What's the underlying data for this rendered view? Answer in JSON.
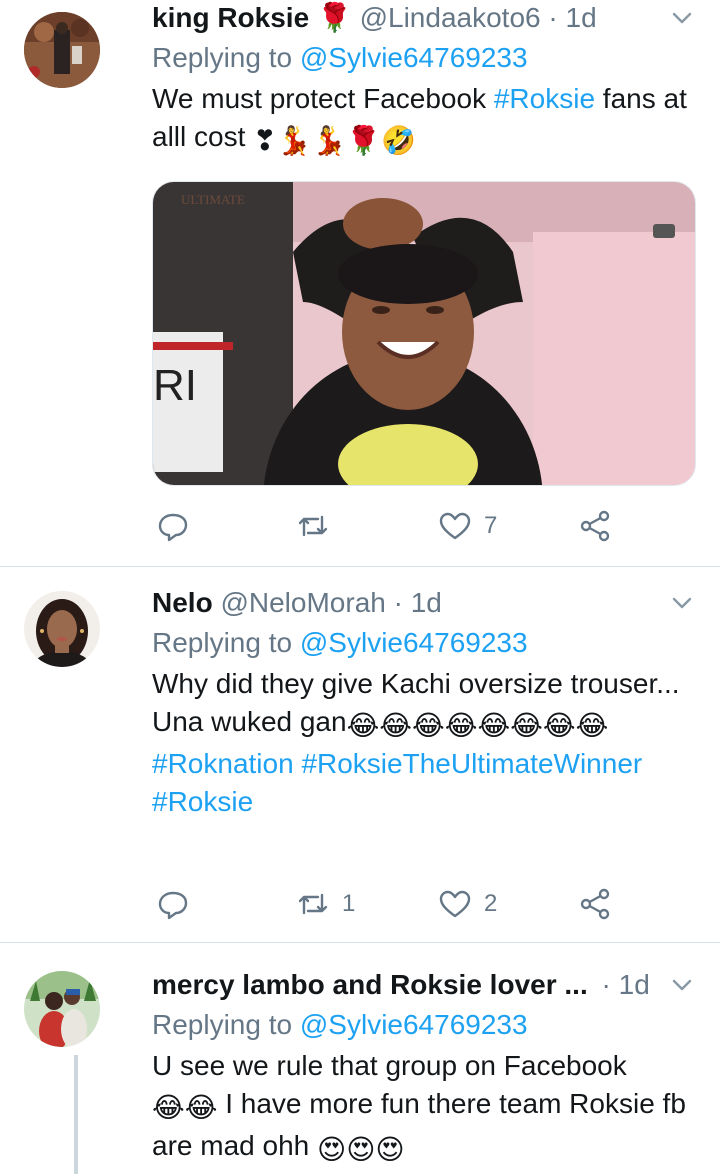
{
  "tweets": [
    {
      "name": "king Roksie 🌹",
      "handle": "@Lindaakoto6",
      "dot": "·",
      "time": "1d",
      "reply_prefix": "Replying to ",
      "reply_to": "@Sylvie64769233",
      "text_1": "We must protect Facebook ",
      "hashtag_1": "#Roksie",
      "text_2": " fans at alll cost",
      "emoji_tail": "❣💃💃🌹🤣",
      "media_overlay_text": "RI",
      "media_logo_text": "ULTIMATE",
      "replies": "",
      "retweets": "",
      "likes": "7"
    },
    {
      "name": "Nelo",
      "handle": "@NeloMorah",
      "dot": "·",
      "time": "1d",
      "reply_prefix": "Replying to ",
      "reply_to": "@Sylvie64769233",
      "text_1": "Why did they give Kachi oversize trouser... Una wuked gan",
      "emoji_tail": "😂😂😂😂😂😂😂😂",
      "hashtag_1": "#Roknation",
      "hashtag_2": "#RoksieTheUltimateWinner",
      "hashtag_3": "#Roksie",
      "replies": "",
      "retweets": "1",
      "likes": "2"
    },
    {
      "name": "mercy lambo and Roksie lover ...",
      "dot": "·",
      "time": "1d",
      "reply_prefix": "Replying to ",
      "reply_to": "@Sylvie64769233",
      "text_1": "U see we rule  that group on Facebook",
      "emoji_mid": "😂😂",
      "text_2": " I have more fun there team Roksie fb are mad ohh ",
      "emoji_tail": "😍😍😍"
    }
  ],
  "colors": {
    "link": "#1da1f2",
    "muted": "#657786",
    "text": "#14171a"
  },
  "icons": [
    "chevron-down-icon",
    "reply-icon",
    "retweet-icon",
    "heart-icon",
    "share-icon"
  ]
}
